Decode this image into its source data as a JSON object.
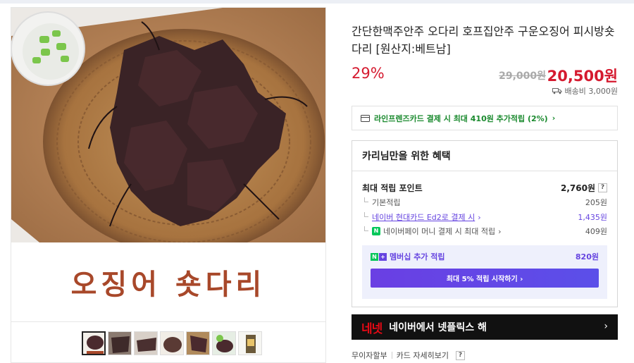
{
  "product": {
    "title": "간단한맥주안주 오다리 호프집안주 구운오징어 피시방숏다리 [원산지:베트남]",
    "discount": "29%",
    "original_price": "29,000원",
    "sale_price": "20,500원",
    "shipping": "배송비 3,000원"
  },
  "media": {
    "caption": "오징어 숏다리",
    "thumbnail_count": 7,
    "selected_thumbnail": 1
  },
  "card_banner": {
    "text": "라인프렌즈카드 결제 시 최대 410원 추가적립 (2%)",
    "arrow": "›"
  },
  "benefits": {
    "heading": "카리님만을 위한 혜택",
    "max_points_label": "최대 적립 포인트",
    "max_points_value": "2,760원",
    "rows": [
      {
        "label": "기본적립",
        "value": "205원"
      },
      {
        "label": "네이버 현대카드 Ed2로 결제 시",
        "value": "1,435원"
      },
      {
        "label": "네이버페이 머니 결제 시 최대 적립",
        "value": "409원"
      }
    ],
    "npay_badge": "N",
    "membership_label": "멤버십 추가 적립",
    "membership_value": "820원",
    "membership_button": "최대 5% 적립 시작하기 ›"
  },
  "netflix_banner": {
    "logo_text": "네넷",
    "text": "네이버에서 넷플릭스 해",
    "arrow": "›"
  },
  "footer": {
    "installment": "무이자할부",
    "card_details": "카드 자세히보기",
    "help": "?"
  },
  "colors": {
    "price_red": "#d51a2f",
    "card_green": "#1a8a2e",
    "naver_purple": "#6645e0",
    "caption_brown": "#a8482a"
  }
}
